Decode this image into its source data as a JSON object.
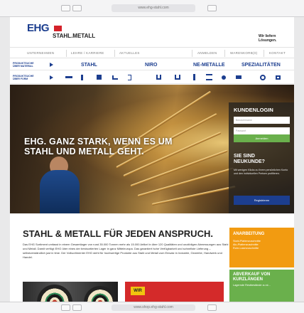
{
  "browser": {
    "url_top": "www.ehg-stahl.com",
    "url_bottom": "www.shop.ehg-stahl.com"
  },
  "header": {
    "logo": "EHG",
    "logo_sub": "STAHL.METALL",
    "slogan": "Wir liefern Lösungen."
  },
  "topnav": {
    "left": [
      "UNTERNEHMEN",
      "LEHRE / KARRIERE",
      "AKTUELLES"
    ],
    "right": [
      "ANMELDEN",
      "WARENKORB(0)",
      "KONTAKT"
    ]
  },
  "categories": {
    "label1": "PRODUKTSUCHE",
    "label1b": "ÜBER MATERIAL",
    "label2": "PRODUKTSUCHE",
    "label2b": "ÜBER FORM",
    "items": [
      "STAHL",
      "NIRO",
      "NE-METALLE",
      "SPEZIALITÄTEN"
    ]
  },
  "hero": {
    "line1": "EHG. GANZ STARK, WENN ES UM",
    "line2": "STAHL UND METALL GEHT."
  },
  "login": {
    "title": "KUNDENLOGIN",
    "user_placeholder": "Benutzername",
    "password_placeholder": "Passwort",
    "submit": "Anmelden",
    "new_title1": "SIE SIND",
    "new_title2": "NEUKUNDE?",
    "new_text": "Mit wenigen Klicks zu Ihrem persönlichen Konto und den individuellen Preisen profitieren.",
    "register": "Registrieren"
  },
  "content": {
    "heading": "STAHL & METALL FÜR JEDEN ANSPRUCH.",
    "paragraph": "Das EHG Sortiment umfasst in einem Gesamtlager von rund 35.000 Tonnen mehr als 15.000 Artikel in über 120 Qualitäten und unzähligen Abmessungen aus Stahl und Metall. Damit verfügt EHG über eines der bestsortierten Lager in ganz Mitteleuropa. Das garantiert hohe Verfügbarkeit und schnellste Lieferung – selbstverständlich just in time. Der Vollsortimenter EHG steht für hochwertige Produkte aus Stahl und Metall zum Einsatz in Industrie, Gewerbe, Handwerk und Handel."
  },
  "side_boxes": {
    "orange_title": "ANARBEITUNG",
    "orange_lines": [
      "Stahl-Plattenzuschnitte",
      "Alu-Plattenzuschnitte",
      "Rohr-Laserzuschnitte"
    ],
    "green_title1": "ABVERKAUF VON",
    "green_title2": "KURZLÄNGEN",
    "green_line": "Lagernde Restbestände zu st..."
  },
  "ads": {
    "red_tag": "WIR"
  },
  "colors": {
    "brand_blue": "#1c3e8f",
    "brand_red": "#d4212a",
    "accent_green": "#6ab04c",
    "accent_orange": "#f29b11"
  }
}
